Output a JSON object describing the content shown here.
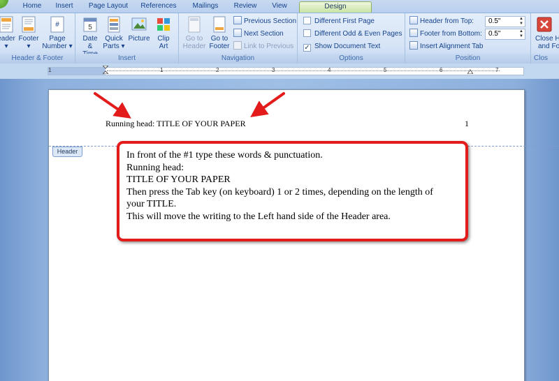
{
  "tabs": [
    {
      "label": "Home"
    },
    {
      "label": "Insert"
    },
    {
      "label": "Page Layout"
    },
    {
      "label": "References"
    },
    {
      "label": "Mailings"
    },
    {
      "label": "Review"
    },
    {
      "label": "View"
    },
    {
      "label": "Design"
    }
  ],
  "active_tab": "Design",
  "ribbon": {
    "header_footer": {
      "label": "Header & Footer",
      "header_line1": "eader",
      "header_line2": "▾",
      "footer_line1": "Footer",
      "footer_line2": "▾",
      "page_number_line1": "Page",
      "page_number_line2": "Number ▾"
    },
    "insert": {
      "label": "Insert",
      "date_line1": "Date",
      "date_line2": "& Time",
      "quick_line1": "Quick",
      "quick_line2": "Parts ▾",
      "picture": "Picture",
      "clip_line1": "Clip",
      "clip_line2": "Art"
    },
    "navigation": {
      "label": "Navigation",
      "goto_header_line1": "Go to",
      "goto_header_line2": "Header",
      "goto_footer_line1": "Go to",
      "goto_footer_line2": "Footer",
      "previous_section": "Previous Section",
      "next_section": "Next Section",
      "link_to_previous": "Link to Previous"
    },
    "options": {
      "label": "Options",
      "different_first_page": "Different First Page",
      "different_odd_even": "Different Odd & Even Pages",
      "show_document_text": "Show Document Text",
      "show_document_text_checked": "✓"
    },
    "position": {
      "label": "Position",
      "header_from_top": "Header from Top:",
      "header_from_top_value": "0.5\"",
      "footer_from_bottom": "Footer from Bottom:",
      "footer_from_bottom_value": "0.5\"",
      "insert_alignment_tab": "Insert Alignment Tab"
    },
    "close": {
      "label": "Clos",
      "close_line1": "Close He",
      "close_line2": "and Fo"
    }
  },
  "ruler": {
    "numbers": [
      "1",
      "1",
      "2",
      "3",
      "4",
      "5",
      "6",
      "7"
    ]
  },
  "document": {
    "header_tag": "Header",
    "running_head": "Running head: TITLE OF YOUR PAPER",
    "page_number": "1"
  },
  "callout": {
    "lines": [
      "In front of the #1 type these words & punctuation.",
      "Running head:",
      "TITLE OF YOUR PAPER",
      "Then press the Tab key (on keyboard) 1 or 2 times, depending on the length of",
      "your TITLE.",
      "This will move the writing to the Left hand side of the Header area."
    ]
  },
  "colors": {
    "annotation_red": "#e31b1b",
    "ribbon_blue": "#d5e3f6",
    "design_tab_green": "#c9e3a3"
  }
}
